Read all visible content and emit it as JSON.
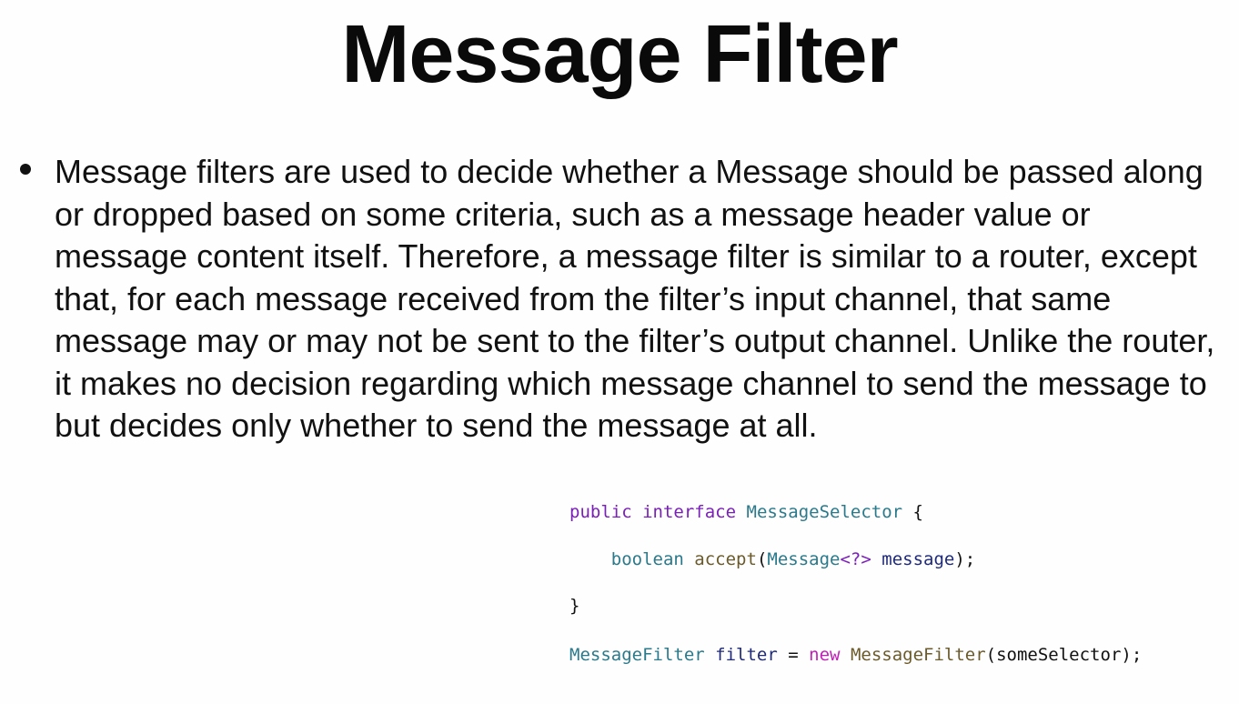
{
  "slide": {
    "title": "Message Filter",
    "bullet": "Message filters are used to decide whether a Message should be passed along or dropped based on some criteria, such as a message header value or message content itself. Therefore, a message filter is similar to a router, except that, for each message received from the filter’s input channel, that same message may or may not be sent to the filter’s output channel. Unlike the router, it makes no decision regarding which message channel to send the message to but decides only whether to send the message at all."
  },
  "code": {
    "line1": {
      "public": "public",
      "interface": "interface",
      "name": "MessageSelector",
      "brace": "{"
    },
    "line2": {
      "indent": "    ",
      "type": "boolean",
      "method": "accept",
      "paren_open": "(",
      "param_type": "Message",
      "generic": "<?>",
      "param_name": "message",
      "end": ");"
    },
    "line3": {
      "brace": "}"
    },
    "line4": {
      "type": "MessageFilter",
      "var": "filter",
      "eq": "=",
      "new": "new",
      "ctor": "MessageFilter",
      "args": "(someSelector);"
    }
  },
  "colors": {
    "keyword": "#7a1fb8",
    "type": "#2a7a8c",
    "method": "#6b5a2a",
    "variable": "#1f2a7a",
    "new_keyword": "#c21fb8"
  }
}
